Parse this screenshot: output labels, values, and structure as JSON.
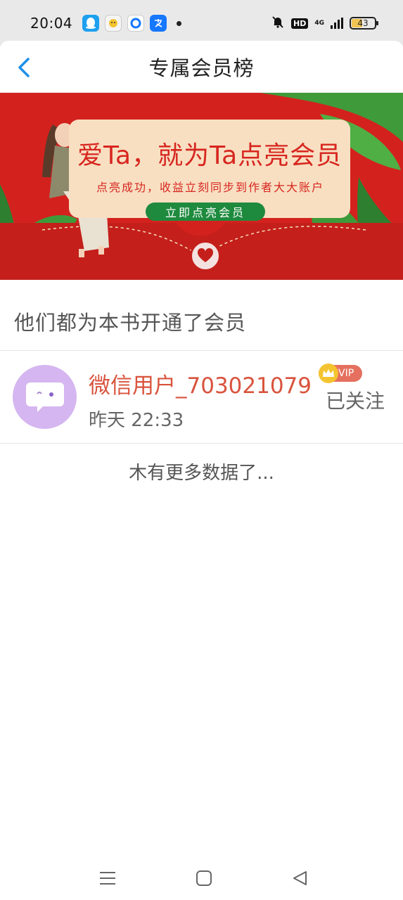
{
  "status_bar": {
    "time": "20:04",
    "network_type": "4G",
    "hd_label": "HD",
    "battery_level": "43",
    "app_icons": [
      "qq-icon",
      "chat-bot-icon",
      "browser-icon",
      "alipay-icon"
    ]
  },
  "header": {
    "title": "专属会员榜"
  },
  "banner": {
    "headline": "爱Ta，就为Ta点亮会员",
    "subtitle": "点亮成功，收益立刻同步到作者大大账户",
    "button_label": "立即点亮会员",
    "background_color": "#d3221e"
  },
  "section": {
    "title": "他们都为本书开通了会员"
  },
  "members": [
    {
      "name": "微信用户_703021079",
      "time": "昨天 22:33",
      "badge": "VIP",
      "follow_label": "已关注"
    }
  ],
  "footer_text": "木有更多数据了...",
  "nav_bar": {
    "buttons": [
      "menu-icon",
      "home-icon",
      "back-icon"
    ]
  }
}
